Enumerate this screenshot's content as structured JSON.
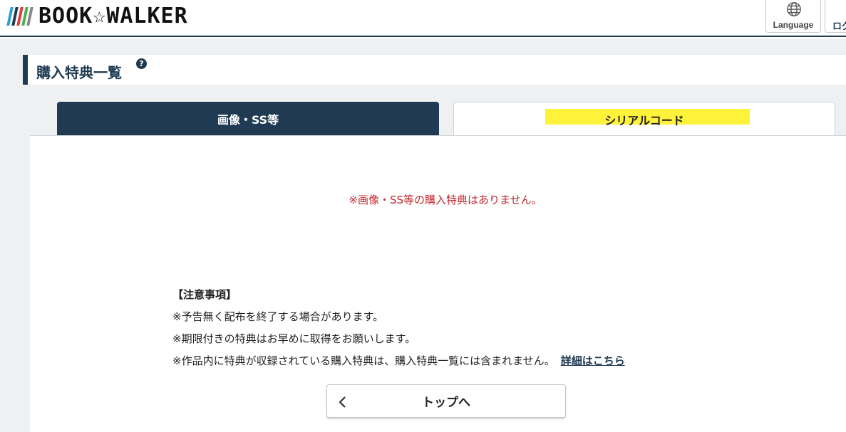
{
  "header": {
    "logo_text": "BOOK☆WALKER",
    "logo_colors": [
      "#2a9fd6",
      "#1f3a52",
      "#e23b3b",
      "#4caf50",
      "#888888"
    ],
    "language_label": "Language",
    "login_label": "ログ"
  },
  "page": {
    "title": "購入特典一覧",
    "help_icon_glyph": "?"
  },
  "tabs": {
    "images_label": "画像・SS等",
    "serial_label": "シリアルコード",
    "active": "images"
  },
  "content": {
    "empty_message": "※画像・SS等の購入特典はありません。",
    "notes_title": "【注意事項】",
    "notes": [
      "※予告無く配布を終了する場合があります。",
      "※期限付きの特典はお早めに取得をお願いします。",
      "※作品内に特典が収録されている購入特典は、購入特典一覧には含まれません。"
    ],
    "details_link": "詳細はこちら",
    "top_button_label": "トップへ"
  },
  "colors": {
    "navy": "#1f3a52",
    "error_red": "#c0282d",
    "highlight_yellow": "#fff23a",
    "background_gray": "#eef0f2"
  }
}
